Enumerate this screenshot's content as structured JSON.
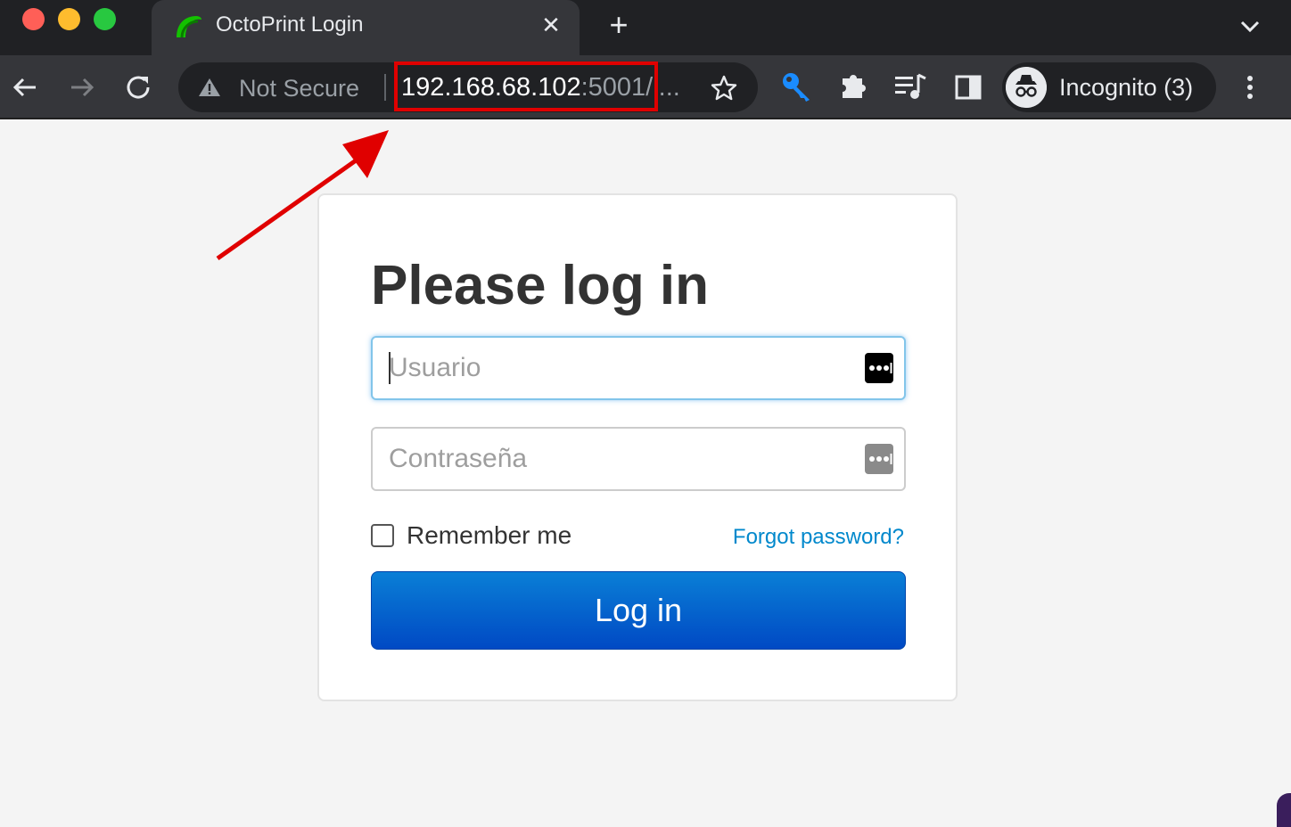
{
  "browser": {
    "tab": {
      "title": "OctoPrint Login",
      "favicon": "octoprint-icon"
    },
    "toolbar": {
      "security_label": "Not Secure",
      "url_host": "192.168.68.102",
      "url_rest": ":5001/l...",
      "profile_label": "Incognito (3)"
    },
    "icons": [
      "back-icon",
      "forward-icon",
      "reload-icon",
      "warning-icon",
      "star-icon",
      "key-extension-icon",
      "puzzle-icon",
      "media-icon",
      "side-panel-icon",
      "incognito-icon",
      "kebab-menu-icon",
      "close-icon",
      "plus-icon",
      "chevron-down-icon"
    ]
  },
  "annotation": {
    "highlight_color": "#e00000",
    "arrow_color": "#e00000"
  },
  "login": {
    "title": "Please log in",
    "username_placeholder": "Usuario",
    "password_placeholder": "Contraseña",
    "remember_label": "Remember me",
    "remember_checked": false,
    "forgot_label": "Forgot password?",
    "submit_label": "Log in"
  },
  "colors": {
    "link": "#0088cc",
    "button_top": "#0a7fd6",
    "button_bottom": "#0049c4",
    "page_bg": "#f4f4f4"
  }
}
